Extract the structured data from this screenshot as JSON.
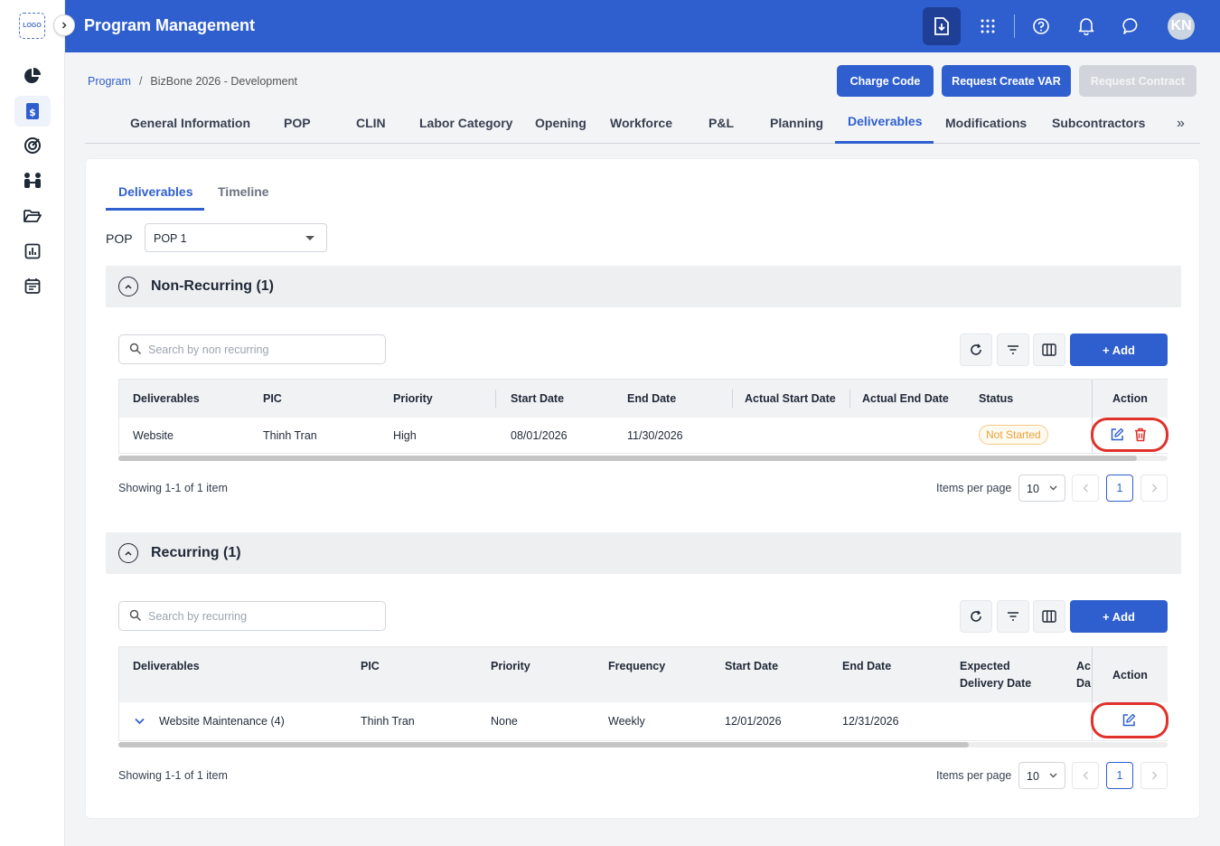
{
  "app": {
    "logo_text": "LOGO",
    "title": "Program Management",
    "user_initials": "KN"
  },
  "breadcrumb": {
    "root": "Program",
    "separator": "/",
    "current": "BizBone 2026 - Development"
  },
  "top_actions": {
    "charge_code": "Charge Code",
    "request_var": "Request Create VAR",
    "request_contract": "Request Contract"
  },
  "main_tabs": [
    "General Information",
    "POP",
    "CLIN",
    "Labor Category",
    "Opening",
    "Workforce",
    "P&L",
    "Planning",
    "Deliverables",
    "Modifications",
    "Subcontractors"
  ],
  "main_tabs_more": "»",
  "sub_tabs": [
    "Deliverables",
    "Timeline"
  ],
  "pop_filter": {
    "label": "POP",
    "value": "POP 1"
  },
  "non_recurring": {
    "title": "Non-Recurring (1)",
    "search_placeholder": "Search by non recurring",
    "add_label": "+ Add",
    "columns": [
      "Deliverables",
      "PIC",
      "Priority",
      "Start Date",
      "End Date",
      "Actual Start Date",
      "Actual End Date",
      "Status"
    ],
    "action_header": "Action",
    "rows": [
      {
        "deliverable": "Website",
        "pic": "Thinh Tran",
        "priority": "High",
        "start": "08/01/2026",
        "end": "11/30/2026",
        "actual_start": "",
        "actual_end": "",
        "status": "Not Started"
      }
    ],
    "showing": "Showing 1-1 of 1 item",
    "items_per_page_label": "Items per page",
    "items_per_page": "10",
    "page": "1"
  },
  "recurring": {
    "title": "Recurring (1)",
    "search_placeholder": "Search by recurring",
    "add_label": "+ Add",
    "columns": [
      "Deliverables",
      "PIC",
      "Priority",
      "Frequency",
      "Start Date",
      "End Date",
      "Expected",
      "Delivery Date",
      "Ac",
      "Da"
    ],
    "action_header": "Action",
    "rows": [
      {
        "deliverable": "Website Maintenance (4)",
        "pic": "Thinh Tran",
        "priority": "None",
        "frequency": "Weekly",
        "start": "12/01/2026",
        "end": "12/31/2026"
      }
    ],
    "showing": "Showing 1-1 of 1 item",
    "items_per_page_label": "Items per page",
    "items_per_page": "10",
    "page": "1"
  },
  "colors": {
    "primary": "#2f5fcf",
    "danger": "#e0312a",
    "status_warning": "#e8a23a"
  }
}
